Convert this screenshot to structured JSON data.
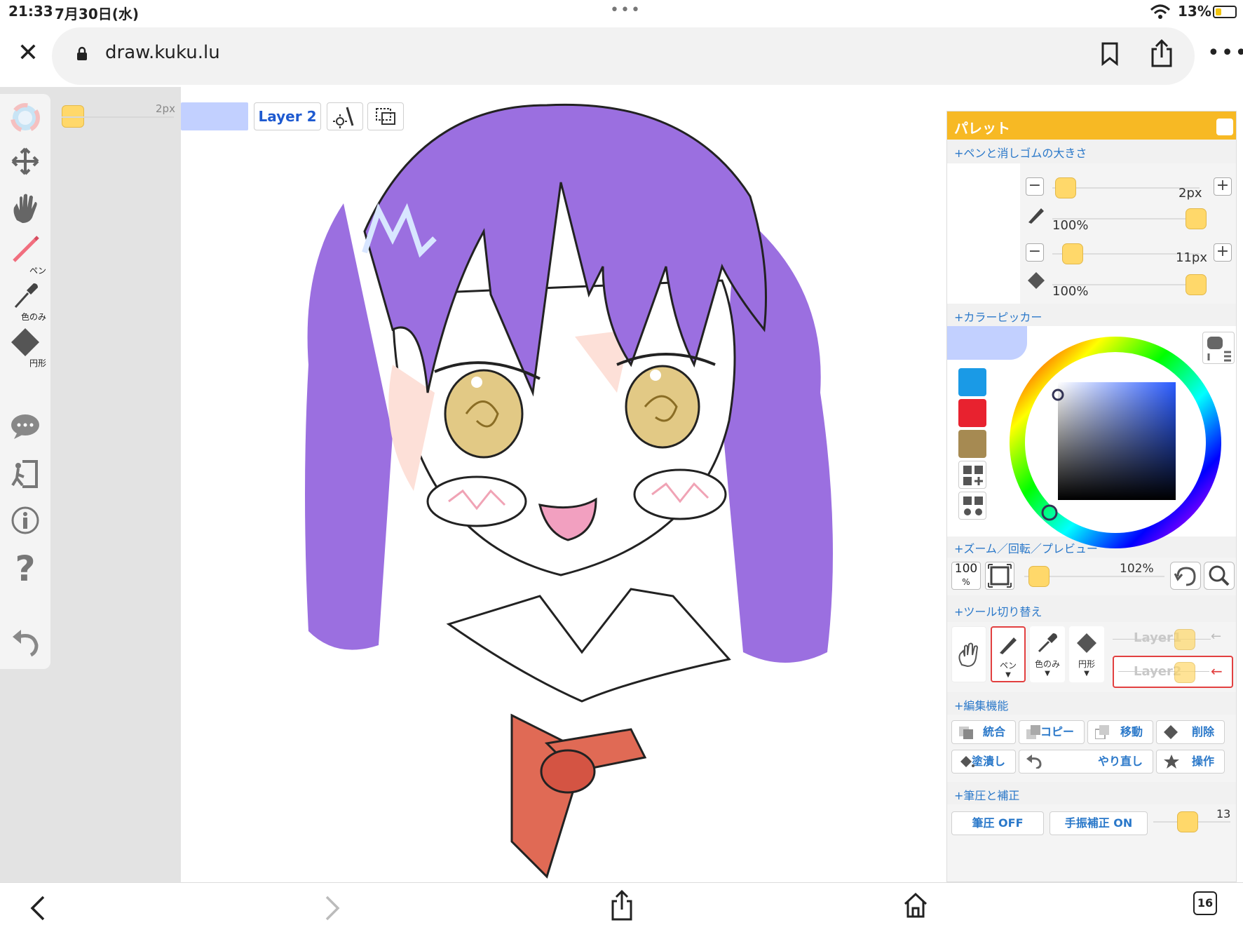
{
  "status": {
    "time": "21:33",
    "date": "7月30日(水)",
    "battery": "13%"
  },
  "browser": {
    "url": "draw.kuku.lu",
    "tab_count": "16"
  },
  "toolbar": {
    "pen_label": "ペン",
    "dropper_label": "色のみ",
    "eraser_label": "円形",
    "size_value": "2px"
  },
  "canvas_bar": {
    "layer_label": "Layer 2",
    "layer_color": "#c2d0ff"
  },
  "palette": {
    "title": "パレット",
    "sections": {
      "pen_size": "+ペンと消しゴムの大きさ",
      "color_picker": "+カラーピッカー",
      "zoom": "+ズーム／回転／プレビュー",
      "tool_switch": "+ツール切り替え",
      "edit": "+編集機能",
      "pressure": "+筆圧と補正"
    },
    "pen": {
      "size": "2px",
      "opacity": "100%"
    },
    "eraser": {
      "size": "11px",
      "opacity": "100%"
    },
    "history_colors": [
      "#1a9ae6",
      "#e8222f",
      "#a68a52"
    ],
    "zoom": {
      "preset": "100",
      "preset_unit": "%",
      "level": "102%"
    },
    "tools": [
      {
        "label": "ペン"
      },
      {
        "label": "色のみ"
      },
      {
        "label": "円形"
      }
    ],
    "layers": [
      "Layer1",
      "Layer2"
    ],
    "edit_buttons": {
      "merge": "統合",
      "copy": "コピー",
      "move": "移動",
      "delete": "削除",
      "fill": "塗潰し",
      "redo": "やり直し",
      "operate": "操作"
    },
    "pressure": {
      "pressure_btn": "筆圧 OFF",
      "stabilizer_btn": "手振補正 ON",
      "value": "13"
    }
  },
  "colors": {
    "accent": "#f7b924",
    "link": "#2a78c9",
    "knob": "#ffd86a"
  }
}
